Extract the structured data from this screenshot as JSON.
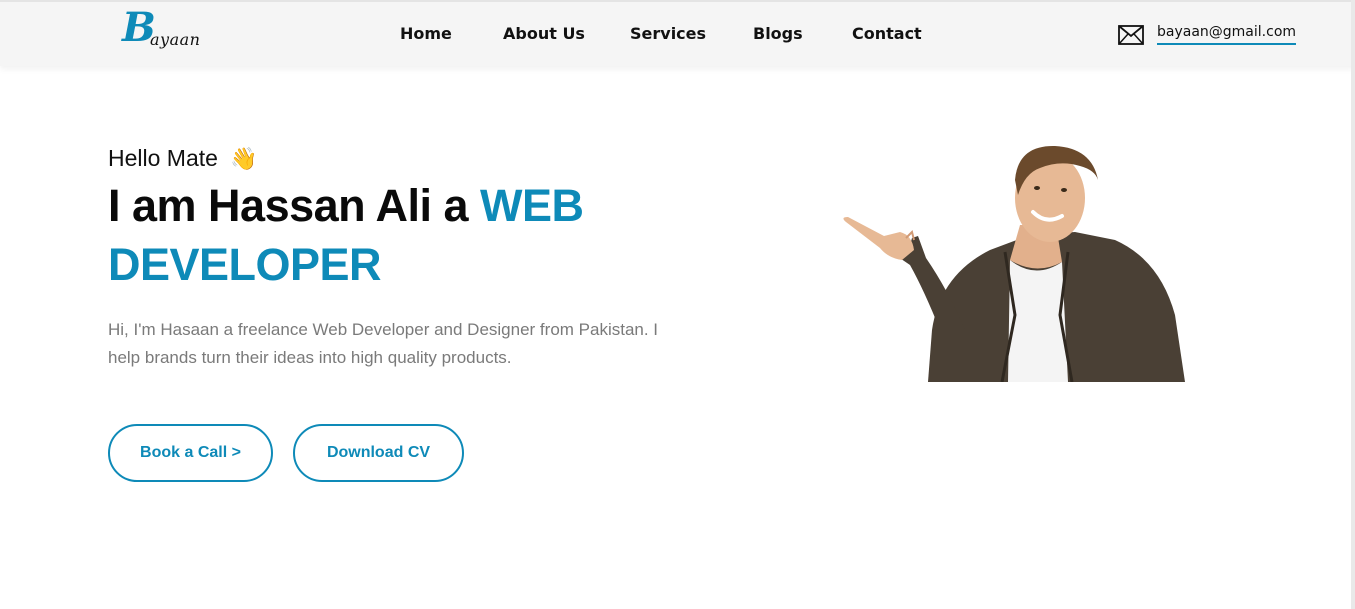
{
  "header": {
    "logo": {
      "initial": "B",
      "rest": "ayaan"
    },
    "nav": [
      {
        "label": "Home"
      },
      {
        "label": "About Us"
      },
      {
        "label": "Services"
      },
      {
        "label": "Blogs"
      },
      {
        "label": "Contact"
      }
    ],
    "email": "bayaan@gmail.com",
    "icons": {
      "mail": "mail-icon"
    }
  },
  "hero": {
    "greeting": "Hello Mate",
    "greeting_emoji": "👋",
    "headline_prefix": "I am Hassan Ali a ",
    "headline_accent": "WEB DEVELOPER",
    "description": "Hi, I'm Hasaan a freelance Web Developer and Designer from Pakistan. I help brands turn their ideas into high quality products.",
    "buttons": {
      "book": "Book a Call >",
      "cv": "Download CV"
    }
  },
  "colors": {
    "accent": "#0e8ab8",
    "text": "#111111",
    "muted": "#7a7a7a",
    "header_bg": "#f5f5f5"
  }
}
